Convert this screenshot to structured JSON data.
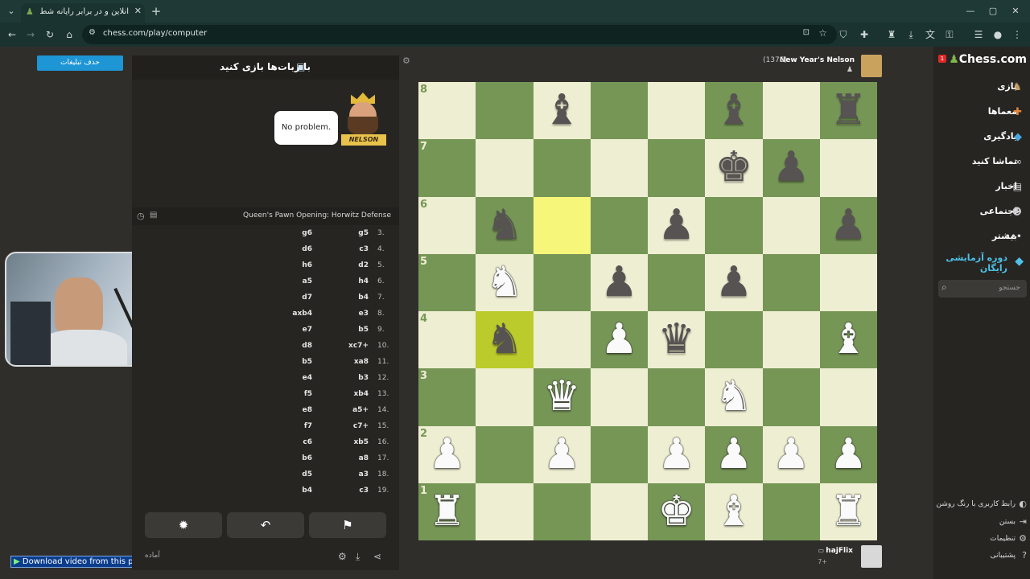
{
  "browser": {
    "tab_title": "آنلاین و در برابر رایانه شطرنج بازی",
    "url": "chess.com/play/computer"
  },
  "left": {
    "ads_button": "حذف تبلیغات",
    "download_bar": "Download video from this page"
  },
  "panel": {
    "title": "با ربات‌ها بازی کنید",
    "bot_name_badge": "NELSON",
    "speech": "No problem.",
    "opening": "Queen's Pawn Opening: Horwitz Defense",
    "moves": [
      {
        "num": "3.",
        "w": "g5",
        "b": "g6"
      },
      {
        "num": "4.",
        "w": "c3",
        "b": "d6"
      },
      {
        "num": "5.",
        "w": "d2",
        "b": "h6"
      },
      {
        "num": "6.",
        "w": "h4",
        "b": "a5"
      },
      {
        "num": "7.",
        "w": "b4",
        "b": "d7"
      },
      {
        "num": "8.",
        "w": "e3",
        "b": "axb4"
      },
      {
        "num": "9.",
        "w": "b5",
        "b": "e7"
      },
      {
        "num": "10.",
        "w": "xc7+",
        "b": "d8"
      },
      {
        "num": "11.",
        "w": "xa8",
        "b": "b5"
      },
      {
        "num": "12.",
        "w": "b3",
        "b": "e4"
      },
      {
        "num": "13.",
        "w": "xb4",
        "b": "f5"
      },
      {
        "num": "14.",
        "w": "a5+",
        "b": "e8"
      },
      {
        "num": "15.",
        "w": "c7+",
        "b": "f7"
      },
      {
        "num": "16.",
        "w": "xb5",
        "b": "c6"
      },
      {
        "num": "17.",
        "w": "a8",
        "b": "b6"
      },
      {
        "num": "18.",
        "w": "a3",
        "b": "d5"
      },
      {
        "num": "19.",
        "w": "c3",
        "b": "b4"
      }
    ],
    "bottom_label": "آماده"
  },
  "opponent": {
    "name": "New Year's Nelson",
    "rating": "(1375)"
  },
  "player": {
    "name": "hajFlix",
    "extra": "7+"
  },
  "board": {
    "files": [
      "a",
      "b",
      "c",
      "d",
      "e",
      "f",
      "g",
      "h"
    ],
    "ranks": [
      "8",
      "7",
      "6",
      "5",
      "4",
      "3",
      "2",
      "1"
    ],
    "pieces": [
      {
        "sq": "c8",
        "p": "bB"
      },
      {
        "sq": "f8",
        "p": "bB"
      },
      {
        "sq": "h8",
        "p": "bR"
      },
      {
        "sq": "f7",
        "p": "bK"
      },
      {
        "sq": "g7",
        "p": "bP"
      },
      {
        "sq": "b6",
        "p": "bN"
      },
      {
        "sq": "e6",
        "p": "bP"
      },
      {
        "sq": "h6",
        "p": "bP"
      },
      {
        "sq": "b5",
        "p": "wN"
      },
      {
        "sq": "d5",
        "p": "bP"
      },
      {
        "sq": "f5",
        "p": "bP"
      },
      {
        "sq": "b4",
        "p": "bN"
      },
      {
        "sq": "d4",
        "p": "wP"
      },
      {
        "sq": "e4",
        "p": "bQ"
      },
      {
        "sq": "h4",
        "p": "wB"
      },
      {
        "sq": "c3",
        "p": "wQ"
      },
      {
        "sq": "f3",
        "p": "wN"
      },
      {
        "sq": "a2",
        "p": "wP"
      },
      {
        "sq": "c2",
        "p": "wP"
      },
      {
        "sq": "e2",
        "p": "wP"
      },
      {
        "sq": "f2",
        "p": "wP"
      },
      {
        "sq": "g2",
        "p": "wP"
      },
      {
        "sq": "h2",
        "p": "wP"
      },
      {
        "sq": "a1",
        "p": "wR"
      },
      {
        "sq": "e1",
        "p": "wK"
      },
      {
        "sq": "f1",
        "p": "wB"
      },
      {
        "sq": "h1",
        "p": "wR"
      }
    ],
    "highlights": [
      "c6",
      "b4"
    ]
  },
  "sidebar": {
    "logo": "Chess.com",
    "notification_count": "1",
    "nav": [
      "بازی",
      "معماها",
      "یادگیری",
      "تماشا کنید",
      "اخبار",
      "اجتماعی",
      "بیشتر"
    ],
    "trial": "دوره آزمایشی رایگان",
    "search_placeholder": "جستجو",
    "bottom": [
      "رابط کاربری با رنگ روشن",
      "بستن",
      "تنظیمات",
      "پشتیبانی"
    ]
  }
}
